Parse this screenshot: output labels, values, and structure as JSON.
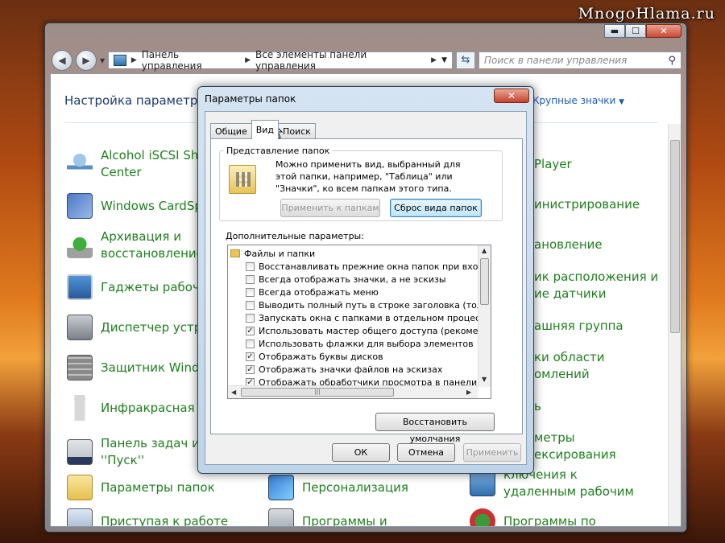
{
  "watermark": "MnogoHlama.ru",
  "address": {
    "crumbs": [
      "Панель управления",
      "Все элементы панели управления"
    ],
    "search_placeholder": "Поиск в панели управления"
  },
  "content": {
    "header": "Настройка параметров",
    "view_by": "Крупные значки",
    "left_items": [
      {
        "line1": "Alcohol iSCSI Sha",
        "line2": "Center",
        "icon": "network-icon"
      },
      {
        "line1": "Windows CardSp",
        "line2": "",
        "icon": "cardspace-icon"
      },
      {
        "line1": "Архивация и",
        "line2": "восстановление",
        "icon": "backup-icon"
      },
      {
        "line1": "Гаджеты рабоче",
        "line2": "",
        "icon": "gadgets-icon"
      },
      {
        "line1": "Диспетчер устро",
        "line2": "",
        "icon": "device-manager-icon"
      },
      {
        "line1": "Защитник Windo",
        "line2": "",
        "icon": "defender-icon"
      },
      {
        "line1": "Инфракрасная св",
        "line2": "",
        "icon": "infrared-icon"
      },
      {
        "line1": "Панель задач и м",
        "line2": "''Пуск''",
        "icon": "taskbar-icon"
      },
      {
        "line1": "Параметры папок",
        "line2": "",
        "icon": "folder-options-icon"
      },
      {
        "line1": "Приступая к работе",
        "line2": "",
        "icon": "getting-started-icon"
      }
    ],
    "mid_items": [
      {
        "line1": "Персонализация",
        "line2": "",
        "icon": "personalization-icon"
      },
      {
        "line1": "Программы и",
        "line2": "",
        "icon": "programs-icon"
      }
    ],
    "right_items": [
      {
        "line1": "Player",
        "line2": ""
      },
      {
        "line1": "инистрирование",
        "line2": ""
      },
      {
        "line1": "ановление",
        "line2": ""
      },
      {
        "line1": "ик расположения и",
        "line2": "ие датчики"
      },
      {
        "line1": "ашняя группа",
        "line2": ""
      },
      {
        "line1": "ки области",
        "line2": "омлений"
      },
      {
        "line1": "ь",
        "line2": ""
      },
      {
        "line1": "метры",
        "line2": "ексирования"
      },
      {
        "line1": "ключения к",
        "line2": "удаленным рабочим"
      },
      {
        "line1": "Программы по",
        "line2": ""
      }
    ]
  },
  "dialog": {
    "title": "Параметры папок",
    "tabs": [
      "Общие",
      "Вид",
      "Поиск"
    ],
    "group_title": "Представление папок",
    "group_desc": "Можно применить вид, выбранный для этой папки, например, \"Таблица\" или \"Значки\", ко всем папкам этого типа.",
    "apply_to_folders": "Применить к папкам",
    "reset_folders": "Сброс вида папок",
    "advanced_label": "Дополнительные параметры:",
    "tree_root": "Файлы и папки",
    "options": [
      {
        "label": "Восстанавливать прежние окна папок при входе в си",
        "checked": false
      },
      {
        "label": "Всегда отображать значки, а не эскизы",
        "checked": false
      },
      {
        "label": "Всегда отображать меню",
        "checked": false
      },
      {
        "label": "Выводить полный путь в строке заголовка (только д",
        "checked": false
      },
      {
        "label": "Запускать окна с папками в отдельном процессе",
        "checked": false
      },
      {
        "label": "Использовать мастер общего доступа (рекомендует",
        "checked": true
      },
      {
        "label": "Использовать флажки для выбора элементов",
        "checked": false
      },
      {
        "label": "Отображать буквы дисков",
        "checked": true
      },
      {
        "label": "Отображать значки файлов на эскизах",
        "checked": true
      },
      {
        "label": "Отображать обработчики просмотра в панели просм",
        "checked": true
      }
    ],
    "restore_defaults": "Восстановить умолчания",
    "ok": "ОК",
    "cancel": "Отмена",
    "apply": "Применить"
  }
}
